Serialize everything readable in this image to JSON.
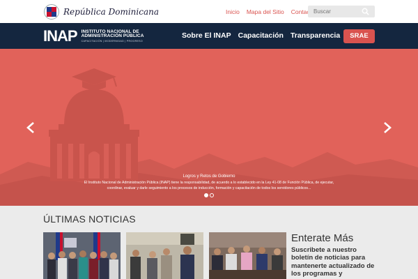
{
  "header": {
    "gov_name": "República Dominicana",
    "links": [
      "Inicio",
      "Mapa del Sitio",
      "Contacto"
    ],
    "search_placeholder": "Buscar"
  },
  "navbar": {
    "logo_mark": "INAP",
    "logo_line1": "INSTITUTO NACIONAL DE",
    "logo_line2": "ADMINISTRACIÓN PÚBLICA",
    "logo_line3": "CAPACITACIÓN | MODERNIDAD | PROGRESO",
    "menu": [
      "Sobre El INAP",
      "Capacitación",
      "Transparencia"
    ],
    "cta_label": "SRAE"
  },
  "hero": {
    "caption_title": "Logros y Retos de Gobierno",
    "caption_text": "El Instituto Nacional de Administración Pública (INAP) tiene la responsabilidad, de acuerdo a lo establecido en la Ley 41-08 de Función Pública, de ejecutar, coordinar, evaluar y darle seguimiento a los procesos de inducción, formación y capacitación de todos los servidores públicos...",
    "slides": 2,
    "active_slide": 1
  },
  "news": {
    "section_title": "ÚLTIMAS NOTICIAS"
  },
  "newsletter": {
    "title": "Enterate Más",
    "text": "Suscribete a nuestro boletín de noticias para mantenerte actualizado de los programas y capacitaciones."
  },
  "colors": {
    "accent": "#d9534f",
    "navbar": "#14263f",
    "hero": "#e1625a"
  }
}
